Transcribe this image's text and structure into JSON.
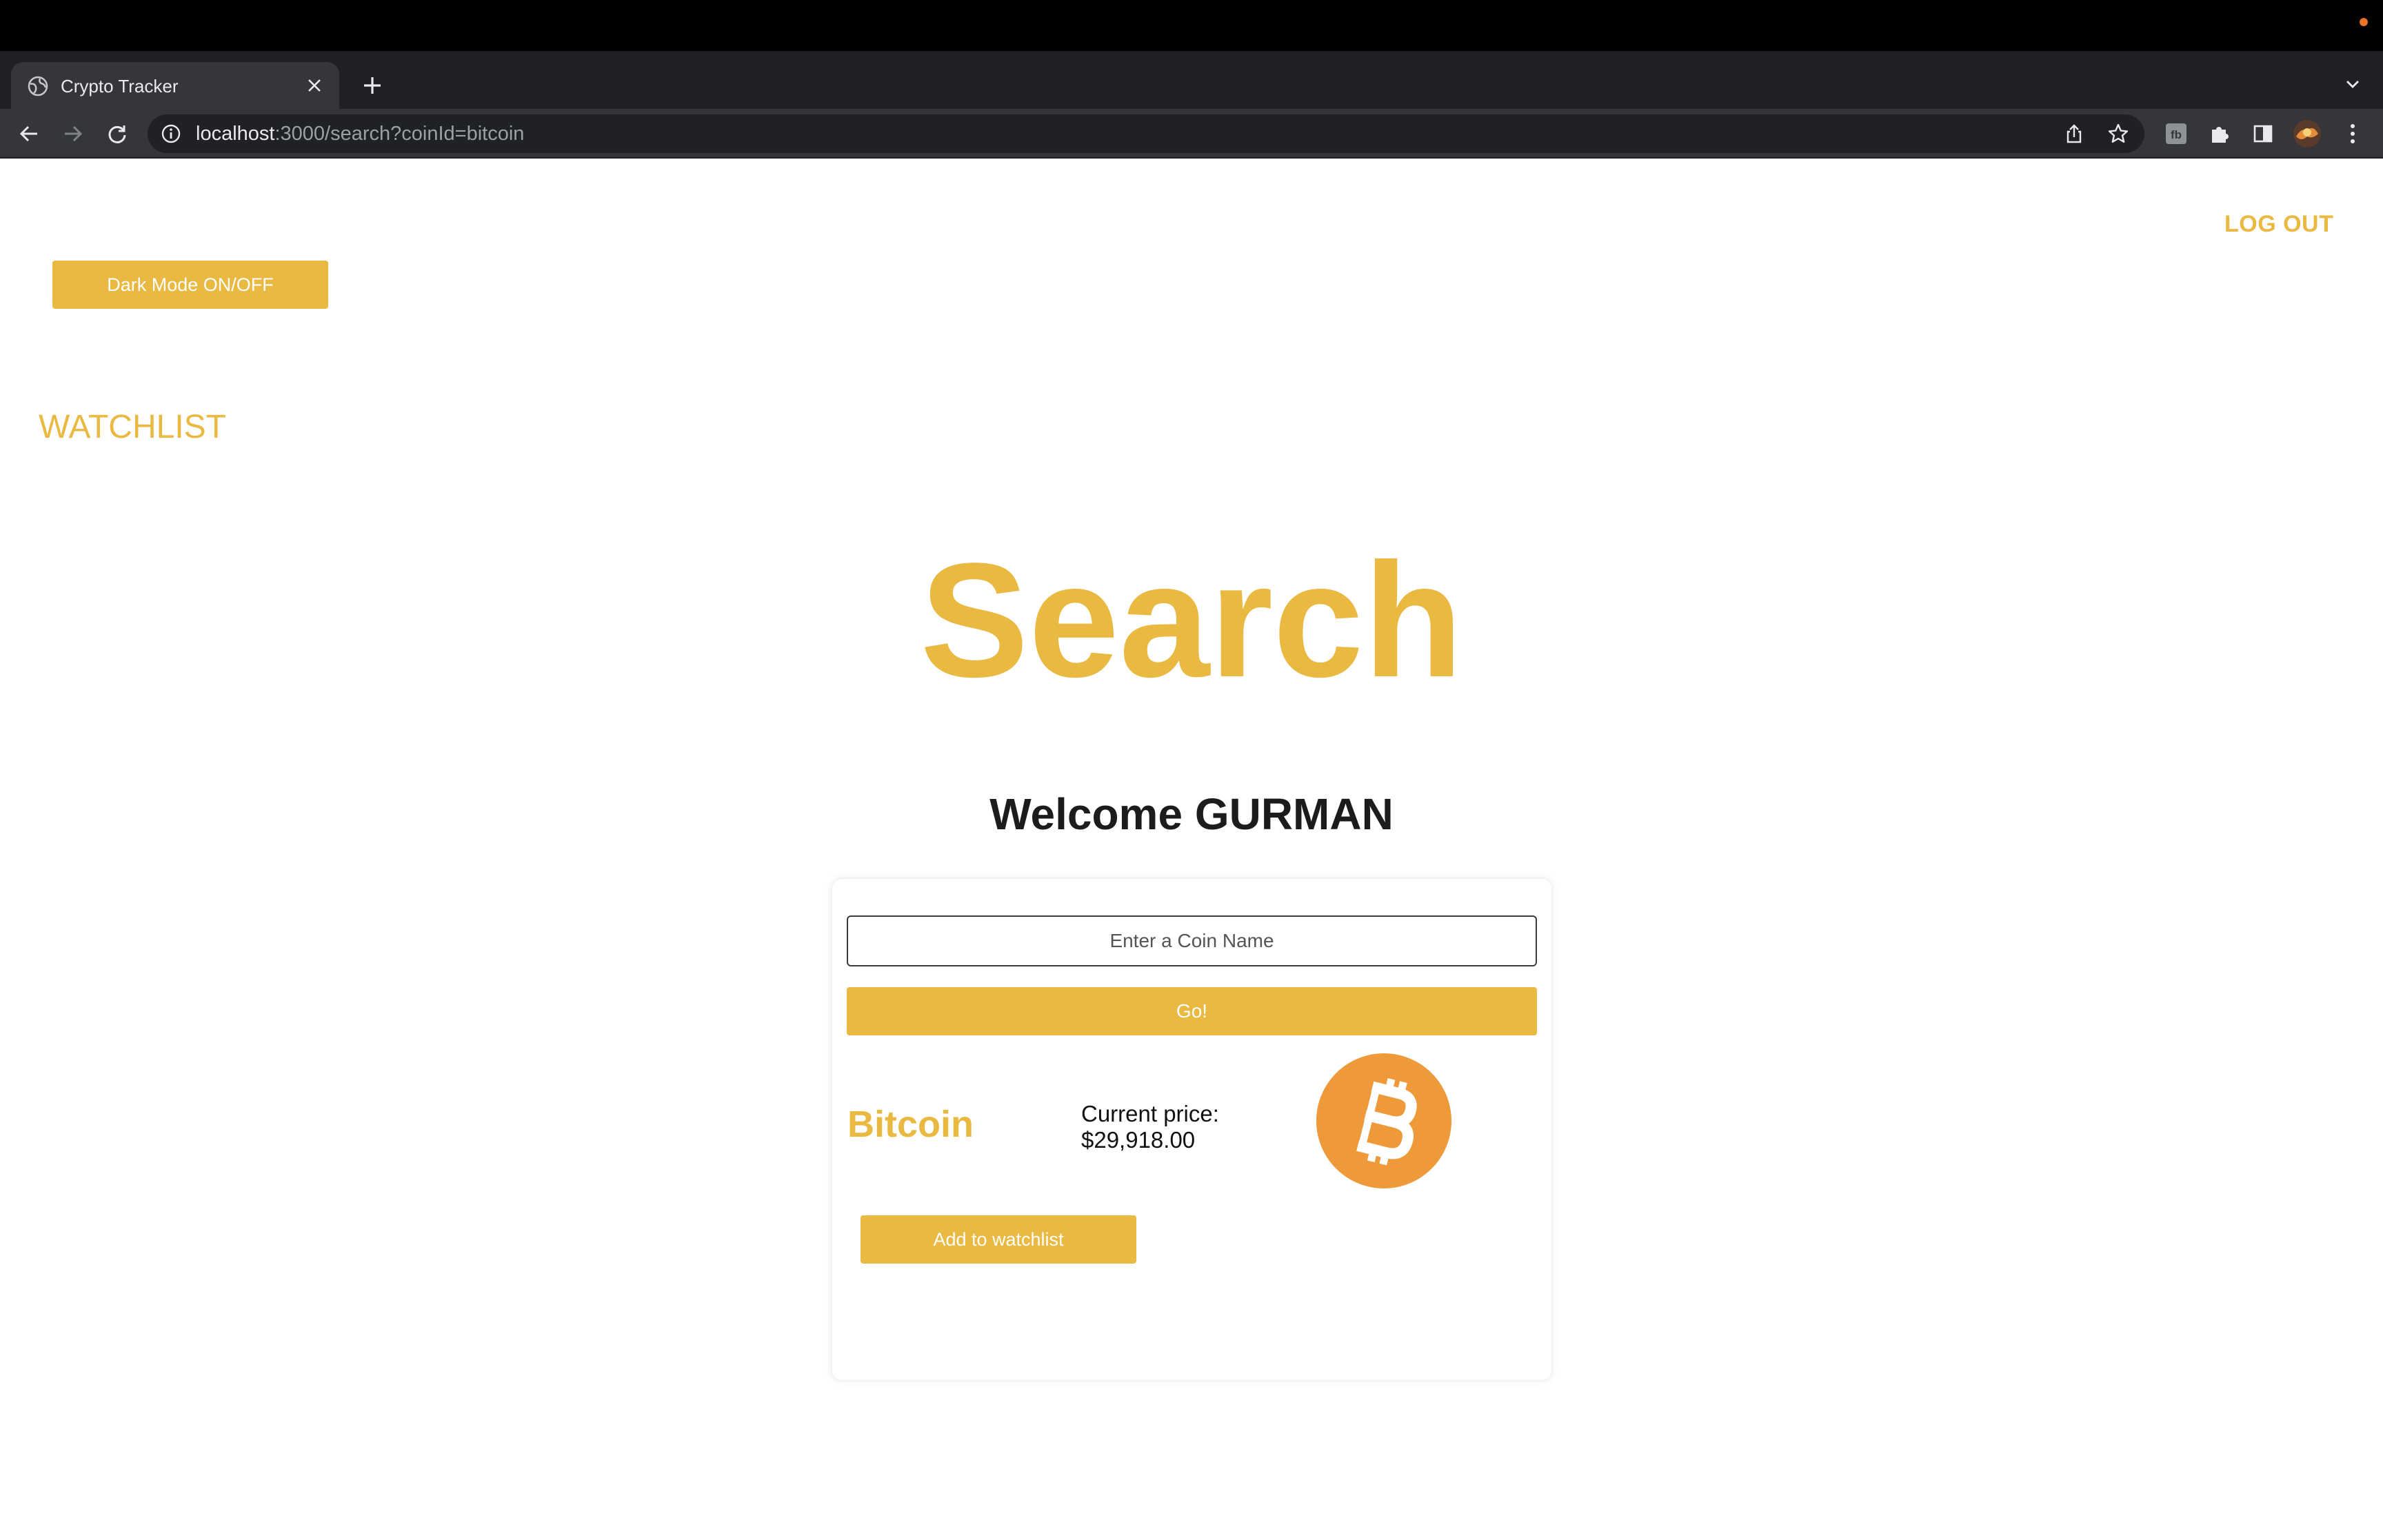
{
  "browser": {
    "tab_title": "Crypto Tracker",
    "url_host": "localhost",
    "url_path": ":3000/search?coinId=bitcoin"
  },
  "icons": {
    "favicon": "globe-icon",
    "close": "close-icon",
    "new_tab": "plus-icon",
    "back": "arrow-left-icon",
    "forward": "arrow-right-icon",
    "reload": "reload-icon",
    "info": "info-icon",
    "share": "share-icon",
    "bookmark": "star-icon",
    "extensions": "puzzle-icon",
    "side_panel": "side-panel-icon",
    "menu": "kebab-menu-icon",
    "coin_logo": "bitcoin-icon"
  },
  "colors": {
    "accent": "#e9b941",
    "bitcoin": "#ee9a3a"
  },
  "header": {
    "logout_label": "LOG OUT",
    "dark_mode_label": "Dark Mode ON/OFF",
    "watchlist_link": "WATCHLIST"
  },
  "main": {
    "title": "Search",
    "welcome": "Welcome GURMAN"
  },
  "search": {
    "placeholder": "Enter a Coin Name",
    "value": "",
    "go_label": "Go!"
  },
  "result": {
    "coin_name": "Bitcoin",
    "price_label": "Current price:",
    "price_value": "$29,918.00",
    "add_label": "Add to watchlist"
  }
}
